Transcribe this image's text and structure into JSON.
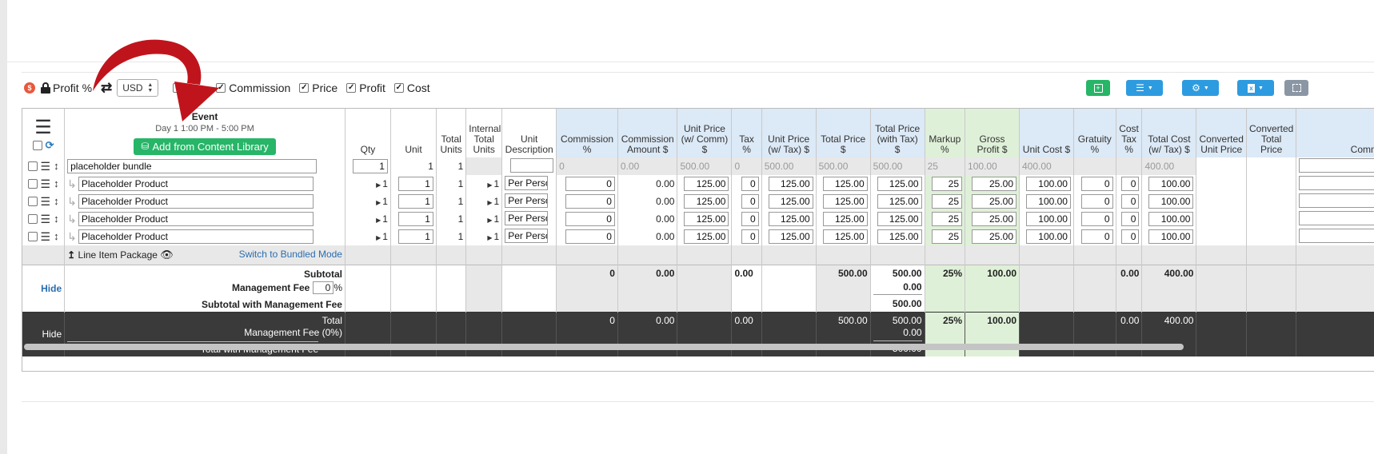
{
  "toolbar": {
    "profit_label": "Profit %",
    "currency": "USD",
    "checkboxes": [
      {
        "label": "Commission",
        "checked": true
      },
      {
        "label": "Price",
        "checked": true
      },
      {
        "label": "Profit",
        "checked": true
      },
      {
        "label": "Cost",
        "checked": true
      }
    ],
    "right_buttons": [
      {
        "name": "add-sheet-button",
        "icon": "spreadsheet-add-icon",
        "color": "#27b568"
      },
      {
        "name": "list-menu-button",
        "icon": "list-icon",
        "color": "#2d9be0"
      },
      {
        "name": "settings-menu-button",
        "icon": "gear-icon",
        "color": "#2d9be0"
      },
      {
        "name": "export-menu-button",
        "icon": "excel-file-icon",
        "color": "#2d9be0"
      },
      {
        "name": "fullscreen-button",
        "icon": "expand-icon",
        "color": "#8b96a5"
      }
    ]
  },
  "event": {
    "title": "Event",
    "date": "Day 1 1:00 PM - 5:00 PM",
    "add_button": "Add from Content Library"
  },
  "columns": {
    "qty": "Qty",
    "unit": "Unit",
    "total_units": "Total Units",
    "internal_total_units": "Internal Total Units",
    "unit_description": "Unit Description",
    "commission_pct": "Commission %",
    "commission_amount": "Commission Amount $",
    "unit_price_comm": "Unit Price (w/ Comm) $",
    "tax_pct": "Tax %",
    "unit_price_tax": "Unit Price (w/ Tax) $",
    "total_price": "Total Price $",
    "total_price_tax": "Total Price (with Tax) $",
    "markup_pct": "Markup %",
    "gross_profit": "Gross Profit $",
    "unit_cost": "Unit Cost $",
    "gratuity_pct": "Gratuity %",
    "cost_tax_pct": "Cost Tax %",
    "total_cost_tax": "Total Cost (w/ Tax) $",
    "converted_unit_price": "Converted Unit Price",
    "converted_total_price": "Converted Total Price",
    "comm": "Comm"
  },
  "bundle_row": {
    "name": "placeholder bundle",
    "qty": "1",
    "unit": "1",
    "total_units": "1",
    "commission_pct": "0",
    "commission_amount": "0.00",
    "unit_price_comm": "500.00",
    "tax_pct": "0",
    "unit_price_tax": "500.00",
    "total_price": "500.00",
    "total_price_tax": "500.00",
    "markup_pct": "25",
    "gross_profit": "100.00",
    "unit_cost": "400.00",
    "total_cost_tax": "400.00"
  },
  "product_rows": [
    {
      "name": "Placeholder Product",
      "qty": "1",
      "unit": "1",
      "total_units": "1",
      "internal_total_units": "1",
      "unit_description": "Per Person",
      "commission_pct": "0",
      "commission_amount": "0.00",
      "unit_price_comm": "125.00",
      "tax_pct": "0",
      "unit_price_tax": "125.00",
      "total_price": "125.00",
      "total_price_tax": "125.00",
      "markup_pct": "25",
      "gross_profit": "25.00",
      "unit_cost": "100.00",
      "gratuity_pct": "0",
      "cost_tax_pct": "0",
      "total_cost_tax": "100.00"
    },
    {
      "name": "Placeholder Product",
      "qty": "1",
      "unit": "1",
      "total_units": "1",
      "internal_total_units": "1",
      "unit_description": "Per Person",
      "commission_pct": "0",
      "commission_amount": "0.00",
      "unit_price_comm": "125.00",
      "tax_pct": "0",
      "unit_price_tax": "125.00",
      "total_price": "125.00",
      "total_price_tax": "125.00",
      "markup_pct": "25",
      "gross_profit": "25.00",
      "unit_cost": "100.00",
      "gratuity_pct": "0",
      "cost_tax_pct": "0",
      "total_cost_tax": "100.00"
    },
    {
      "name": "Placeholder Product",
      "qty": "1",
      "unit": "1",
      "total_units": "1",
      "internal_total_units": "1",
      "unit_description": "Per Person",
      "commission_pct": "0",
      "commission_amount": "0.00",
      "unit_price_comm": "125.00",
      "tax_pct": "0",
      "unit_price_tax": "125.00",
      "total_price": "125.00",
      "total_price_tax": "125.00",
      "markup_pct": "25",
      "gross_profit": "25.00",
      "unit_cost": "100.00",
      "gratuity_pct": "0",
      "cost_tax_pct": "0",
      "total_cost_tax": "100.00"
    },
    {
      "name": "Placeholder Product",
      "qty": "1",
      "unit": "1",
      "total_units": "1",
      "internal_total_units": "1",
      "unit_description": "Per Person",
      "commission_pct": "0",
      "commission_amount": "0.00",
      "unit_price_comm": "125.00",
      "tax_pct": "0",
      "unit_price_tax": "125.00",
      "total_price": "125.00",
      "total_price_tax": "125.00",
      "markup_pct": "25",
      "gross_profit": "25.00",
      "unit_cost": "100.00",
      "gratuity_pct": "0",
      "cost_tax_pct": "0",
      "total_cost_tax": "100.00"
    }
  ],
  "package": {
    "label": "Line Item Package",
    "switch_link": "Switch to Bundled Mode"
  },
  "subtotal": {
    "hide": "Hide",
    "label": "Subtotal",
    "mgmt_label": "Management Fee",
    "mgmt_value": "0",
    "mgmt_unit": "%",
    "with_fee_label": "Subtotal with Management Fee",
    "commission_pct": "0",
    "commission_amount": "0.00",
    "tax": "0.00",
    "total_price": "500.00",
    "total_price_tax": "500.00",
    "mgmt_fee_amount": "0.00",
    "total_with_fee": "500.00",
    "markup": "25%",
    "gross_profit": "100.00",
    "cost_tax": "0.00",
    "total_cost": "400.00"
  },
  "total": {
    "hide": "Hide",
    "label": "Total",
    "mgmt_label": "Management Fee (0%)",
    "with_fee_label": "Total with Management Fee",
    "commission_pct": "0",
    "commission_amount": "0.00",
    "tax": "0.00",
    "total_price": "500.00",
    "total_price_tax": "500.00",
    "mgmt_fee_amount": "0.00",
    "total_with_fee": "500.00",
    "markup": "25%",
    "gross_profit": "100.00",
    "cost_tax": "0.00",
    "total_cost": "400.00"
  },
  "colors": {
    "header_blue": "#dce9f6",
    "profit_green": "#dff0d8",
    "primary_green": "#27b568",
    "primary_blue": "#2d9be0",
    "total_dark": "#3a3a3a",
    "annotation_red": "#c0141c"
  }
}
